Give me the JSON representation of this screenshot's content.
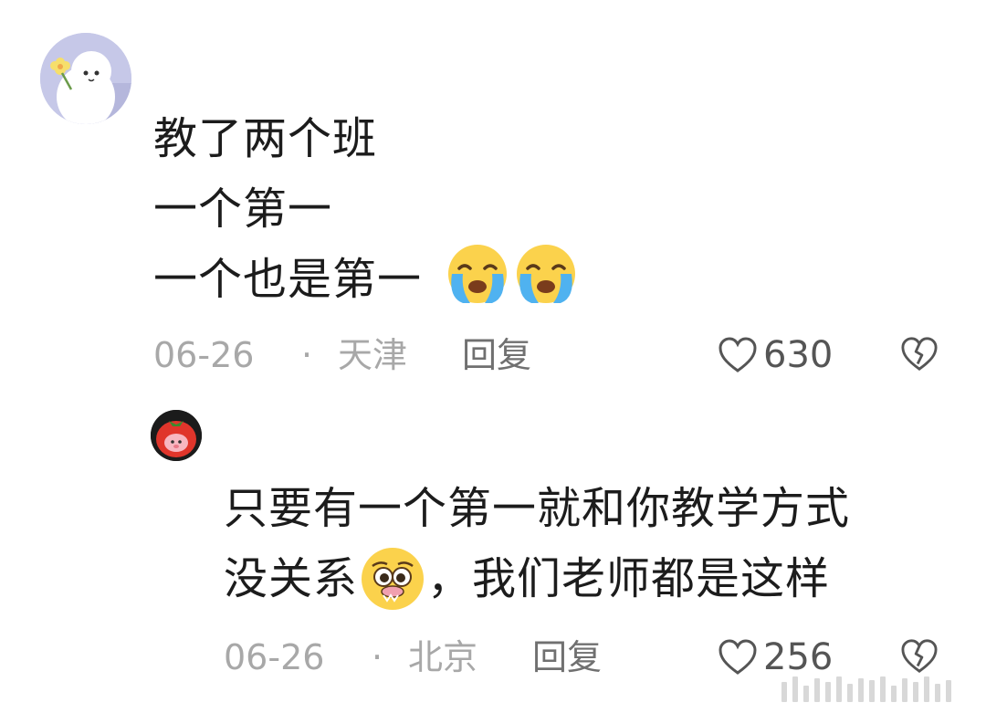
{
  "comment_1": {
    "lines": [
      "教了两个班",
      "一个第一",
      "一个也是第一"
    ],
    "date": "06-26",
    "separator": "·",
    "location": "天津",
    "reply_label": "回复",
    "likes": "630"
  },
  "comment_2": {
    "line_1": "只要有一个第一就和你教学方式",
    "line_2_before_emoji": "没关系",
    "line_2_after_emoji": "，我们老师都是这样",
    "date": "06-26",
    "separator": "·",
    "location": "北京",
    "reply_label": "回复",
    "likes": "256"
  },
  "colors": {
    "meta": "#a8a8a8",
    "text": "#1c1c1c",
    "reply": "#707070"
  }
}
